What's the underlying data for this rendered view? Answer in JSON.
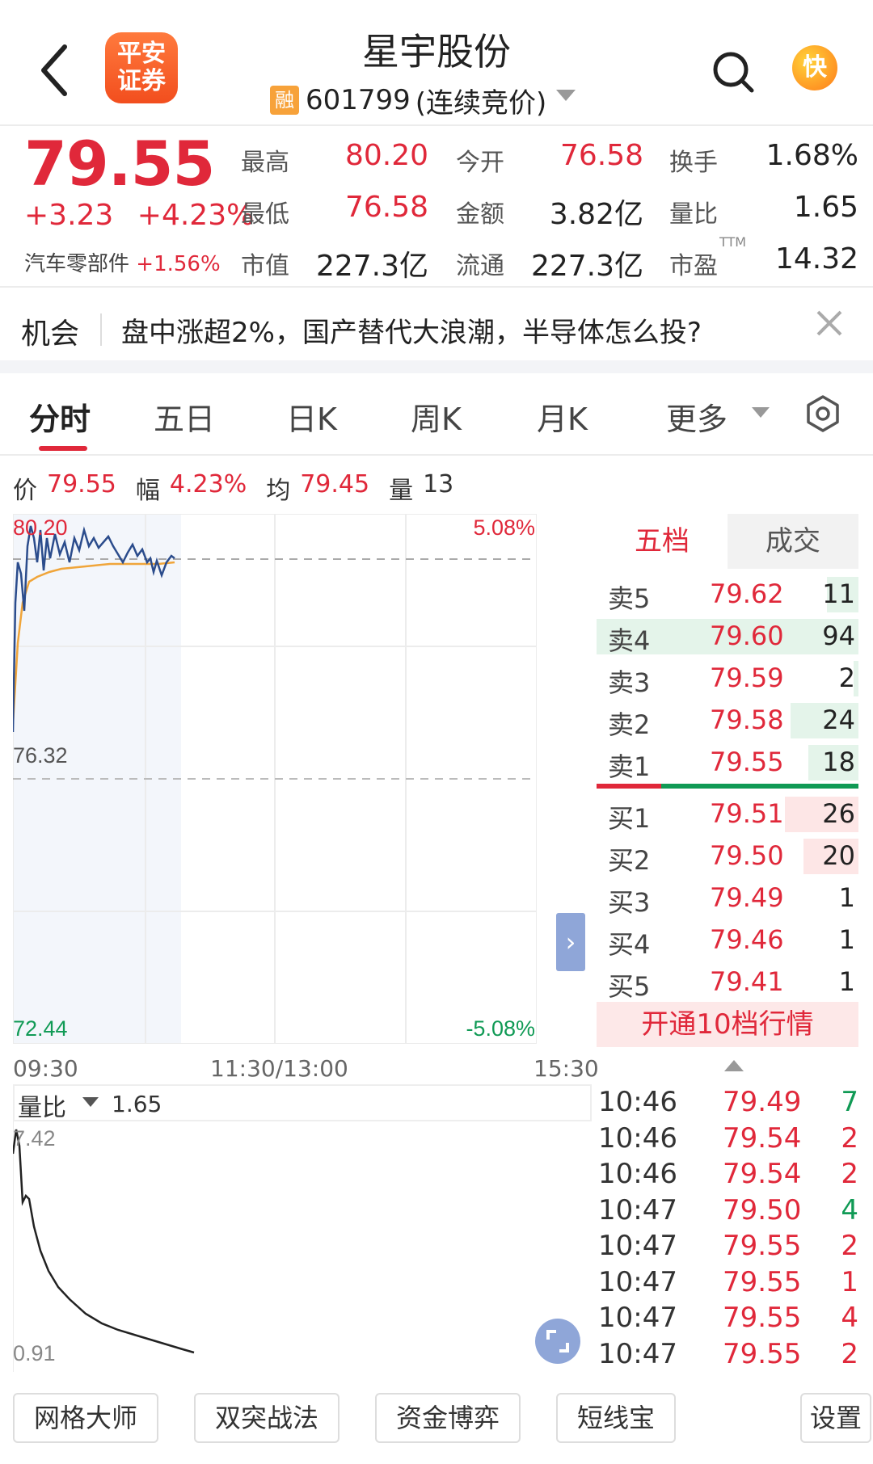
{
  "header": {
    "title": "星宇股份",
    "badge": "融",
    "code": "601799",
    "status": "(连续竞价)",
    "brand_line1": "平安",
    "brand_line2": "证券",
    "kuai": "快"
  },
  "quote": {
    "price": "79.55",
    "change": "+3.23",
    "change_pct": "+4.23%",
    "sector": "汽车零部件",
    "sector_pct": "+1.56%",
    "stats": [
      {
        "label": "最高",
        "value": "80.20",
        "color": "#e0283a"
      },
      {
        "label": "今开",
        "value": "76.58",
        "color": "#e0283a"
      },
      {
        "label": "换手",
        "value": "1.68%",
        "color": "#222222"
      },
      {
        "label": "最低",
        "value": "76.58",
        "color": "#e0283a"
      },
      {
        "label": "金额",
        "value": "3.82亿",
        "color": "#222222"
      },
      {
        "label": "量比",
        "value": "1.65",
        "color": "#222222"
      },
      {
        "label": "市值",
        "value": "227.3亿",
        "color": "#222222"
      },
      {
        "label": "流通",
        "value": "227.3亿",
        "color": "#222222"
      },
      {
        "label": "市盈",
        "value": "14.32",
        "color": "#222222"
      }
    ],
    "ttm": "TTM"
  },
  "opportunity": {
    "label": "机会",
    "text": "盘中涨超2%，国产替代大浪潮，半导体怎么投?"
  },
  "tabs": [
    "分时",
    "五日",
    "日K",
    "周K",
    "月K",
    "更多"
  ],
  "active_tab": "分时",
  "chart_info": {
    "price_label": "价",
    "price": "79.55",
    "range_label": "幅",
    "range": "4.23%",
    "avg_label": "均",
    "avg": "79.45",
    "vol_label": "量",
    "vol": "13"
  },
  "chart_axes": {
    "top": "80.20",
    "mid": "76.32",
    "bottom": "72.44",
    "top_pct": "5.08%",
    "bottom_pct": "-5.08%",
    "t_start": "09:30",
    "t_mid": "11:30/13:00",
    "t_end": "15:30"
  },
  "orderbook": {
    "tabs": [
      "五档",
      "成交"
    ],
    "asks": [
      {
        "label": "卖5",
        "price": "79.62",
        "vol": "11",
        "share": 0.12
      },
      {
        "label": "卖4",
        "price": "79.60",
        "vol": "94",
        "share": 1.0
      },
      {
        "label": "卖3",
        "price": "79.59",
        "vol": "2",
        "share": 0.02
      },
      {
        "label": "卖2",
        "price": "79.58",
        "vol": "24",
        "share": 0.26
      },
      {
        "label": "卖1",
        "price": "79.55",
        "vol": "18",
        "share": 0.19
      }
    ],
    "bids": [
      {
        "label": "买1",
        "price": "79.51",
        "vol": "26",
        "share": 0.28
      },
      {
        "label": "买2",
        "price": "79.50",
        "vol": "20",
        "share": 0.21
      },
      {
        "label": "买3",
        "price": "79.49",
        "vol": "1",
        "share": 0.0
      },
      {
        "label": "买4",
        "price": "79.46",
        "vol": "1",
        "share": 0.0
      },
      {
        "label": "买5",
        "price": "79.41",
        "vol": "1",
        "share": 0.0
      }
    ],
    "open10": "开通10档行情"
  },
  "volume_ratio": {
    "label": "量比",
    "value": "1.65",
    "top": "7.42",
    "bottom": "0.91"
  },
  "trades": [
    {
      "time": "10:46",
      "price": "79.49",
      "vol": "7",
      "color": "#109a55"
    },
    {
      "time": "10:46",
      "price": "79.54",
      "vol": "2",
      "color": "#e0283a"
    },
    {
      "time": "10:46",
      "price": "79.54",
      "vol": "2",
      "color": "#e0283a"
    },
    {
      "time": "10:47",
      "price": "79.50",
      "vol": "4",
      "color": "#109a55"
    },
    {
      "time": "10:47",
      "price": "79.55",
      "vol": "2",
      "color": "#e0283a"
    },
    {
      "time": "10:47",
      "price": "79.55",
      "vol": "1",
      "color": "#e0283a"
    },
    {
      "time": "10:47",
      "price": "79.55",
      "vol": "4",
      "color": "#e0283a"
    },
    {
      "time": "10:47",
      "price": "79.55",
      "vol": "2",
      "color": "#e0283a"
    }
  ],
  "bottom_buttons": [
    "网格大师",
    "双突战法",
    "资金博弈",
    "短线宝",
    "设置"
  ],
  "colors": {
    "up": "#e0283a",
    "down": "#109a55",
    "price_line": "#2b4c8c",
    "avg_line": "#f0a53a"
  }
}
